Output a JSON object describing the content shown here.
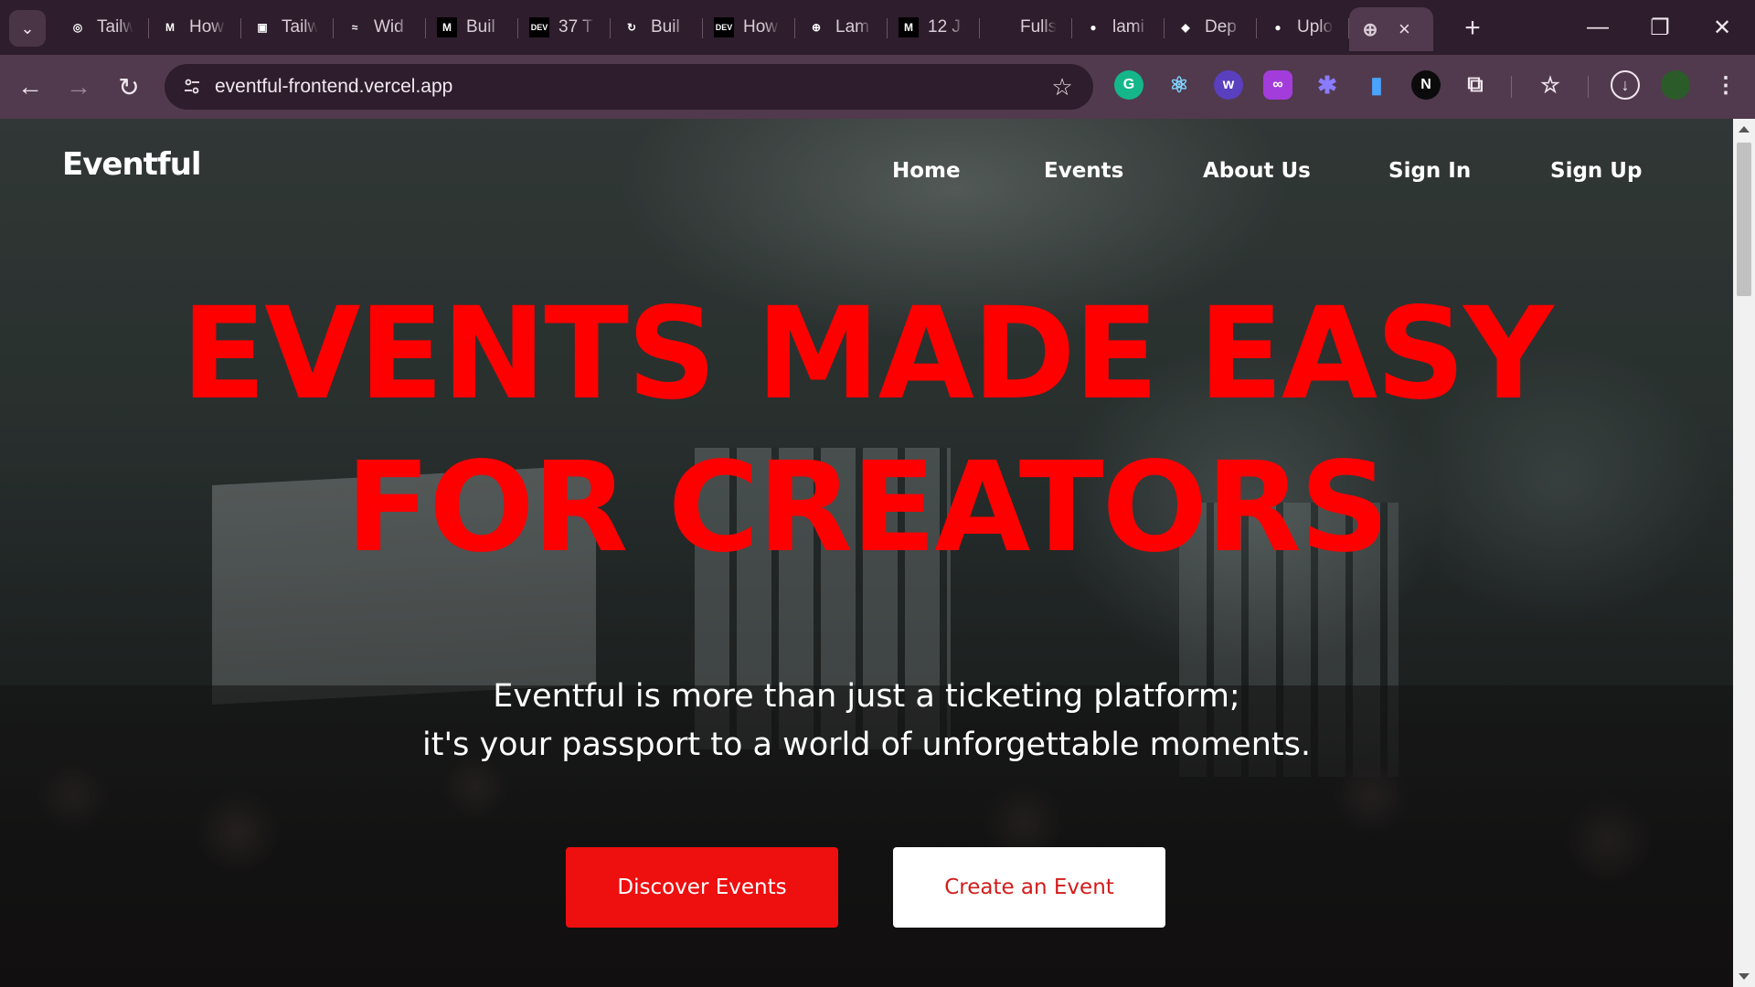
{
  "browser": {
    "tabs": [
      {
        "title": "Tailw",
        "icon": "openai-icon",
        "favicon_text": "◎",
        "favicon_color": "#2e1d2c"
      },
      {
        "title": "How",
        "icon": "medium-icon",
        "favicon_text": "M",
        "favicon_color": "#2e1d2c"
      },
      {
        "title": "Tailw",
        "icon": "page-icon",
        "favicon_text": "▣",
        "favicon_color": "#2e1d2c"
      },
      {
        "title": "Wid",
        "icon": "tailwind-icon",
        "favicon_text": "≈",
        "favicon_color": "#2e1d2c"
      },
      {
        "title": "Buil",
        "icon": "medium-icon",
        "favicon_text": "M",
        "favicon_color": "#000000"
      },
      {
        "title": "37 T",
        "icon": "dev-icon",
        "favicon_text": "DEV",
        "favicon_color": "#000000"
      },
      {
        "title": "Buil",
        "icon": "refresh-logo-icon",
        "favicon_text": "↻",
        "favicon_color": "#2e1d2c"
      },
      {
        "title": "How",
        "icon": "dev-icon",
        "favicon_text": "DEV",
        "favicon_color": "#000000"
      },
      {
        "title": "Lam",
        "icon": "globe-icon",
        "favicon_text": "⊕",
        "favicon_color": "#2e1d2c"
      },
      {
        "title": "12 J",
        "icon": "medium-icon",
        "favicon_text": "M",
        "favicon_color": "#000000"
      },
      {
        "title": "Fulls",
        "icon": "blank-icon",
        "favicon_text": "",
        "favicon_color": "#2e1d2c"
      },
      {
        "title": "lami",
        "icon": "github-icon",
        "favicon_text": "●",
        "favicon_color": "#2e1d2c"
      },
      {
        "title": "Dep",
        "icon": "diamond-icon",
        "favicon_text": "◆",
        "favicon_color": "#2e1d2c"
      },
      {
        "title": "Uplo",
        "icon": "github-icon",
        "favicon_text": "●",
        "favicon_color": "#2e1d2c"
      }
    ],
    "active_tab_close": "×",
    "new_tab": "+",
    "window_controls": {
      "minimize": "—",
      "restore": "❐",
      "close": "✕"
    },
    "url": "eventful-frontend.vercel.app",
    "nav": {
      "back": "←",
      "forward": "→",
      "reload": "↻"
    },
    "star": "☆"
  },
  "site": {
    "logo": "Eventful",
    "nav": [
      {
        "label": "Home"
      },
      {
        "label": "Events"
      },
      {
        "label": "About Us"
      },
      {
        "label": "Sign In"
      },
      {
        "label": "Sign Up"
      }
    ],
    "headline_line1": "EVENTS MADE EASY",
    "headline_line2": "FOR CREATORS",
    "subtext_line1": "Eventful is more than just a ticketing platform;",
    "subtext_line2": "it's your passport to a world of unforgettable moments.",
    "primary_cta": "Discover Events",
    "secondary_cta": "Create an Event"
  },
  "colors": {
    "accent_red": "#ff0000",
    "button_red": "#ee0f0f",
    "browser_frame": "#2e1d2c",
    "toolbar": "#513a4d"
  }
}
